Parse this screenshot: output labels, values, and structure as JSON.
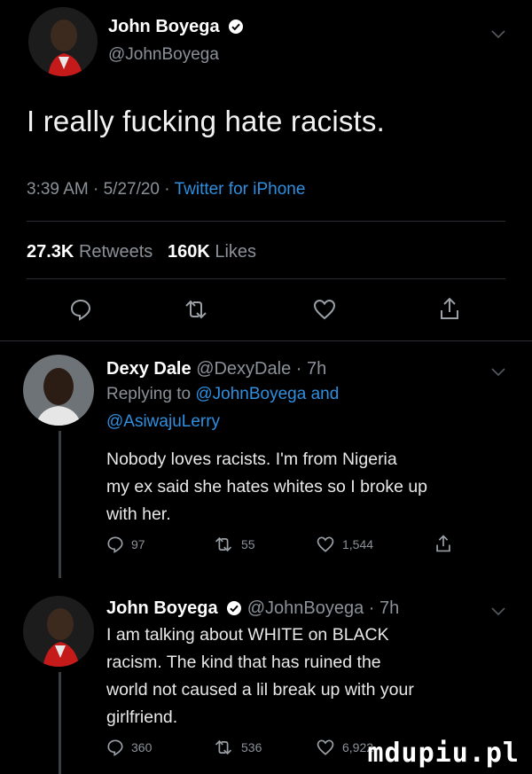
{
  "tweet": {
    "author_name": "John Boyega",
    "author_handle": "@JohnBoyega",
    "text": "I really fucking hate racists.",
    "time": "3:39 AM",
    "date": "5/27/20",
    "source": "Twitter for iPhone",
    "retweets_count": "27.3K",
    "retweets_label": "Retweets",
    "likes_count": "160K",
    "likes_label": "Likes"
  },
  "reply1": {
    "author_name": "Dexy Dale",
    "author_handle": "@DexyDale",
    "age": "7h",
    "replying_prefix": "Replying to",
    "replying_user1": "@JohnBoyega",
    "replying_and": "and",
    "replying_user2": "@AsiwajuLerry",
    "lines": [
      "Nobody loves racists. I'm from Nigeria",
      "my ex said she hates whites so I broke up",
      "with her."
    ],
    "replies": "97",
    "retweets": "55",
    "likes": "1,544"
  },
  "reply2": {
    "author_name": "John Boyega",
    "author_handle": "@JohnBoyega",
    "age": "7h",
    "lines": [
      "I am talking about WHITE on BLACK",
      "racism. The kind that has ruined the",
      "world not caused a lil break up with your",
      "girlfriend."
    ],
    "replies": "360",
    "retweets": "536",
    "likes": "6,922"
  },
  "separator": "·",
  "watermark": "mdupiu.pl",
  "colors": {
    "background": "#000000",
    "link": "#2f8fe0",
    "muted": "#8b9198",
    "verified": "#ffffff"
  },
  "icons": [
    "reply-icon",
    "retweet-icon",
    "heart-icon",
    "share-icon",
    "chevron-down-icon",
    "verified-icon"
  ]
}
